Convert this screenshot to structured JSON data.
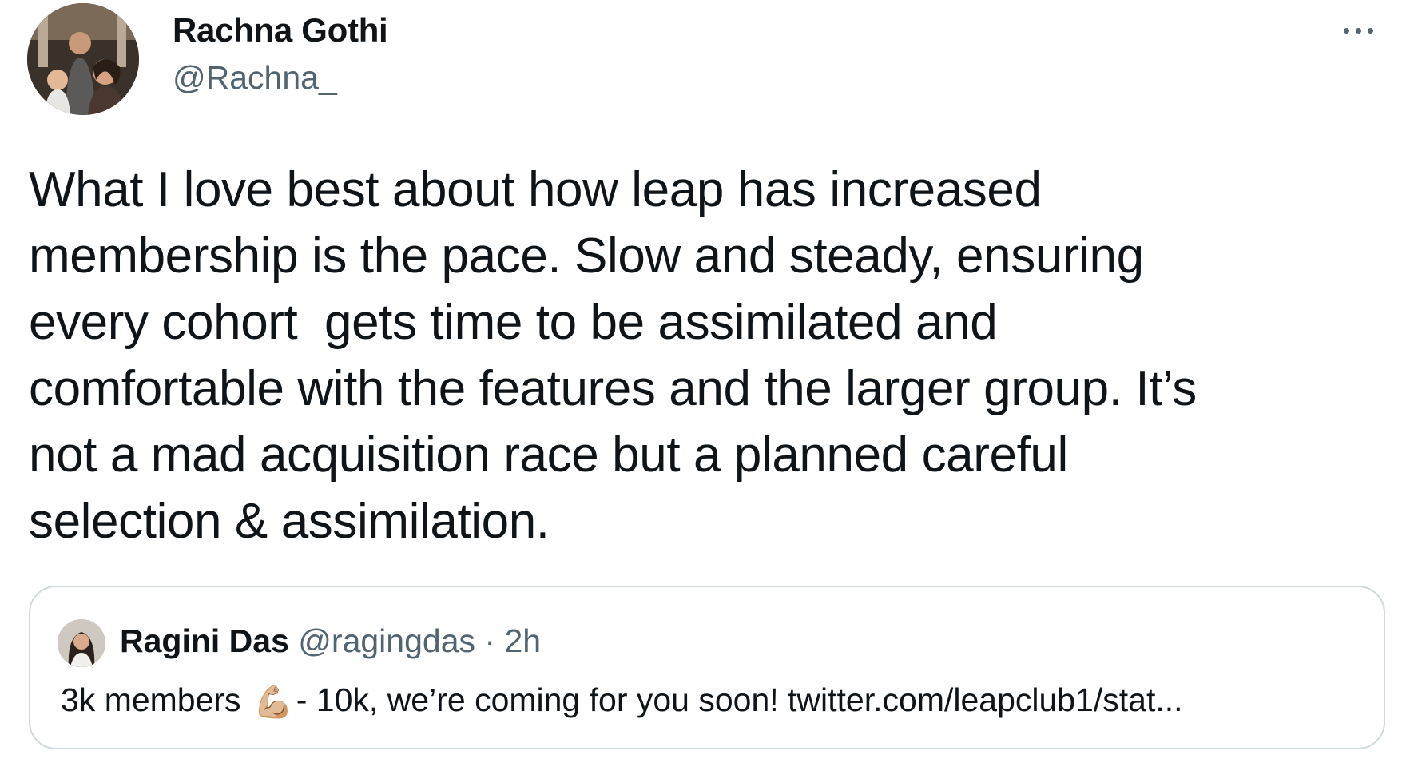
{
  "author": {
    "display_name": "Rachna Gothi",
    "handle": "@Rachna_"
  },
  "more_icon": "more-horizontal-icon",
  "tweet": {
    "lines": [
      "What I love best about how leap has increased",
      "membership is the pace. Slow and steady, ensuring",
      "every cohort  gets time to be assimilated and",
      "comfortable with the features and the larger group. It’s",
      "not a mad acquisition race but a planned careful",
      "selection & assimilation."
    ]
  },
  "quote": {
    "display_name": "Ragini Das",
    "handle": "@ragingdas",
    "separator": "·",
    "time": "2h",
    "text_before_emoji": "3k members ",
    "emoji": "💪🏼",
    "text_after_emoji": "- 10k, we’re coming for you soon! twitter.com/leapclub1/stat..."
  },
  "colors": {
    "text_primary": "#0f1419",
    "text_secondary": "#536471",
    "border": "#cfd9de",
    "background": "#ffffff"
  }
}
